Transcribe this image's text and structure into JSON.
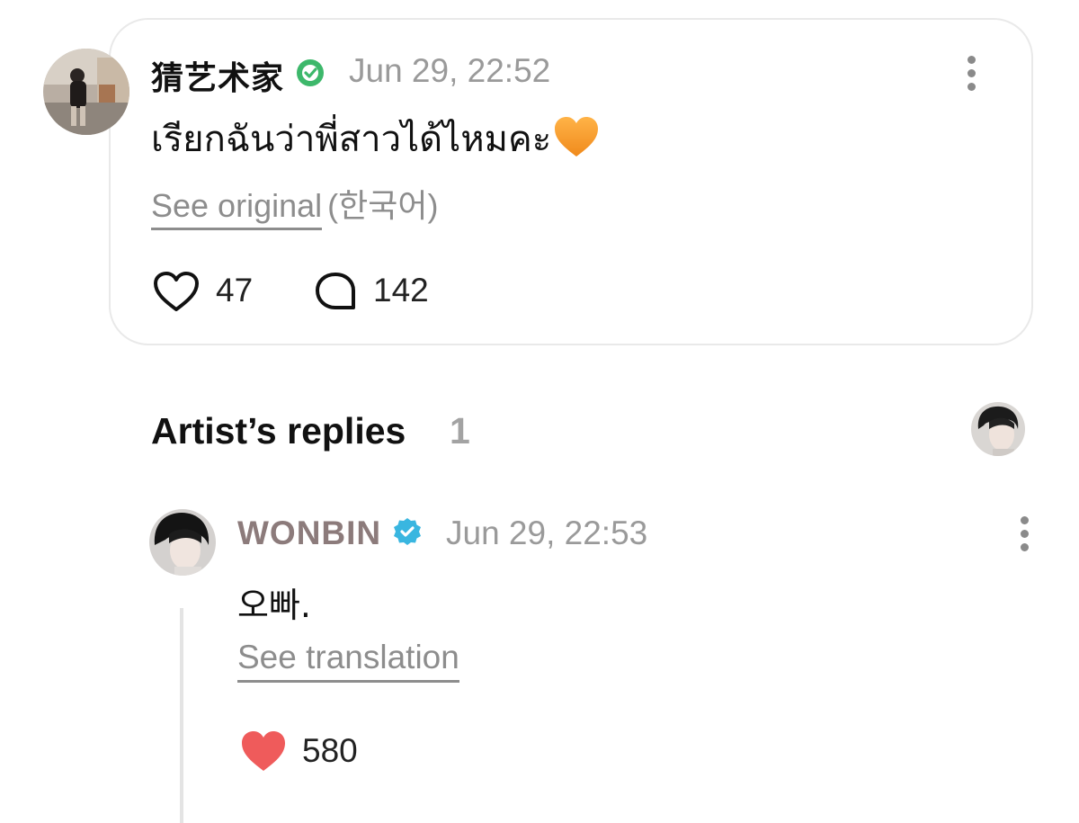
{
  "post": {
    "author": "猜艺术家",
    "verified_icon": "verified-check-icon",
    "verified_color": "#3db86b",
    "date": "Jun 29, 22:52",
    "text": "เรียกฉันว่าพี่สาวได้ไหมคะ",
    "emoji": "orange-heart-icon",
    "see_original": "See original",
    "original_language": "(한국어)",
    "likes": "47",
    "comments": "142"
  },
  "artist_replies": {
    "title": "Artist’s replies",
    "count": "1"
  },
  "reply": {
    "author": "WONBIN",
    "verified_color": "#39b6e0",
    "date": "Jun 29, 22:53",
    "text": "오빠.",
    "see_translation": "See translation",
    "likes": "580",
    "like_color": "#ef5b5b"
  }
}
